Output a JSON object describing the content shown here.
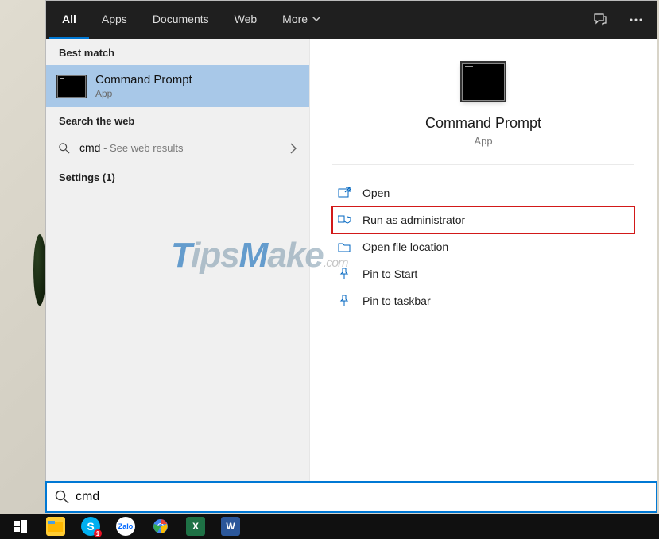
{
  "tabs": {
    "items": [
      "All",
      "Apps",
      "Documents",
      "Web",
      "More"
    ],
    "active_index": 0
  },
  "left": {
    "best_match_header": "Best match",
    "best_match": {
      "title": "Command Prompt",
      "subtitle": "App"
    },
    "search_web_header": "Search the web",
    "web_query": "cmd",
    "web_suffix": " - See web results",
    "settings_header": "Settings (1)"
  },
  "right": {
    "app_name": "Command Prompt",
    "app_type": "App",
    "actions": [
      {
        "icon": "open-icon",
        "label": "Open"
      },
      {
        "icon": "admin-icon",
        "label": "Run as administrator",
        "highlight": true
      },
      {
        "icon": "folder-icon",
        "label": "Open file location"
      },
      {
        "icon": "pin-start-icon",
        "label": "Pin to Start"
      },
      {
        "icon": "pin-taskbar-icon",
        "label": "Pin to taskbar"
      }
    ]
  },
  "search": {
    "value": "cmd",
    "placeholder": ""
  },
  "taskbar": {
    "items": [
      {
        "name": "start-button",
        "color": "#fff"
      },
      {
        "name": "file-explorer-icon",
        "color": "#ffcc33"
      },
      {
        "name": "skype-icon",
        "color": "#00aff0",
        "badge": "1"
      },
      {
        "name": "zalo-icon",
        "color": "#0068ff"
      },
      {
        "name": "chrome-icon",
        "color": ""
      },
      {
        "name": "excel-icon",
        "color": "#1e7145"
      },
      {
        "name": "word-icon",
        "color": "#2b579a"
      }
    ]
  },
  "watermark": {
    "text": "TipsMake",
    "suffix": ".com"
  }
}
